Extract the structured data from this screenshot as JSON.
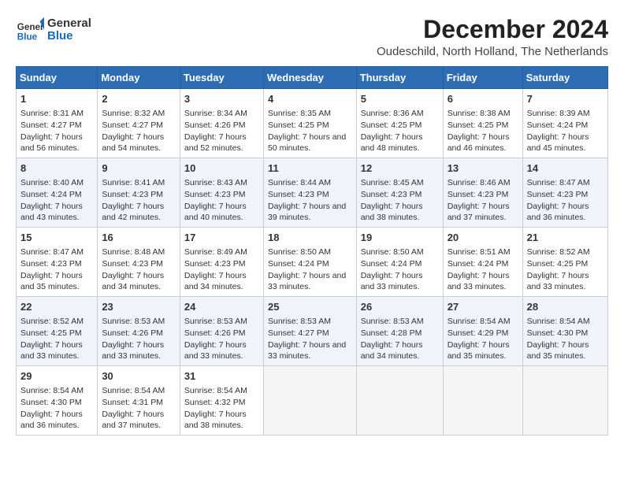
{
  "header": {
    "logo_general": "General",
    "logo_blue": "Blue",
    "title": "December 2024",
    "location": "Oudeschild, North Holland, The Netherlands"
  },
  "calendar": {
    "days_of_week": [
      "Sunday",
      "Monday",
      "Tuesday",
      "Wednesday",
      "Thursday",
      "Friday",
      "Saturday"
    ],
    "weeks": [
      [
        {
          "day": 1,
          "sunrise": "8:31 AM",
          "sunset": "4:27 PM",
          "daylight": "7 hours and 56 minutes."
        },
        {
          "day": 2,
          "sunrise": "8:32 AM",
          "sunset": "4:27 PM",
          "daylight": "7 hours and 54 minutes."
        },
        {
          "day": 3,
          "sunrise": "8:34 AM",
          "sunset": "4:26 PM",
          "daylight": "7 hours and 52 minutes."
        },
        {
          "day": 4,
          "sunrise": "8:35 AM",
          "sunset": "4:25 PM",
          "daylight": "7 hours and 50 minutes."
        },
        {
          "day": 5,
          "sunrise": "8:36 AM",
          "sunset": "4:25 PM",
          "daylight": "7 hours and 48 minutes."
        },
        {
          "day": 6,
          "sunrise": "8:38 AM",
          "sunset": "4:25 PM",
          "daylight": "7 hours and 46 minutes."
        },
        {
          "day": 7,
          "sunrise": "8:39 AM",
          "sunset": "4:24 PM",
          "daylight": "7 hours and 45 minutes."
        }
      ],
      [
        {
          "day": 8,
          "sunrise": "8:40 AM",
          "sunset": "4:24 PM",
          "daylight": "7 hours and 43 minutes."
        },
        {
          "day": 9,
          "sunrise": "8:41 AM",
          "sunset": "4:23 PM",
          "daylight": "7 hours and 42 minutes."
        },
        {
          "day": 10,
          "sunrise": "8:43 AM",
          "sunset": "4:23 PM",
          "daylight": "7 hours and 40 minutes."
        },
        {
          "day": 11,
          "sunrise": "8:44 AM",
          "sunset": "4:23 PM",
          "daylight": "7 hours and 39 minutes."
        },
        {
          "day": 12,
          "sunrise": "8:45 AM",
          "sunset": "4:23 PM",
          "daylight": "7 hours and 38 minutes."
        },
        {
          "day": 13,
          "sunrise": "8:46 AM",
          "sunset": "4:23 PM",
          "daylight": "7 hours and 37 minutes."
        },
        {
          "day": 14,
          "sunrise": "8:47 AM",
          "sunset": "4:23 PM",
          "daylight": "7 hours and 36 minutes."
        }
      ],
      [
        {
          "day": 15,
          "sunrise": "8:47 AM",
          "sunset": "4:23 PM",
          "daylight": "7 hours and 35 minutes."
        },
        {
          "day": 16,
          "sunrise": "8:48 AM",
          "sunset": "4:23 PM",
          "daylight": "7 hours and 34 minutes."
        },
        {
          "day": 17,
          "sunrise": "8:49 AM",
          "sunset": "4:23 PM",
          "daylight": "7 hours and 34 minutes."
        },
        {
          "day": 18,
          "sunrise": "8:50 AM",
          "sunset": "4:24 PM",
          "daylight": "7 hours and 33 minutes."
        },
        {
          "day": 19,
          "sunrise": "8:50 AM",
          "sunset": "4:24 PM",
          "daylight": "7 hours and 33 minutes."
        },
        {
          "day": 20,
          "sunrise": "8:51 AM",
          "sunset": "4:24 PM",
          "daylight": "7 hours and 33 minutes."
        },
        {
          "day": 21,
          "sunrise": "8:52 AM",
          "sunset": "4:25 PM",
          "daylight": "7 hours and 33 minutes."
        }
      ],
      [
        {
          "day": 22,
          "sunrise": "8:52 AM",
          "sunset": "4:25 PM",
          "daylight": "7 hours and 33 minutes."
        },
        {
          "day": 23,
          "sunrise": "8:53 AM",
          "sunset": "4:26 PM",
          "daylight": "7 hours and 33 minutes."
        },
        {
          "day": 24,
          "sunrise": "8:53 AM",
          "sunset": "4:26 PM",
          "daylight": "7 hours and 33 minutes."
        },
        {
          "day": 25,
          "sunrise": "8:53 AM",
          "sunset": "4:27 PM",
          "daylight": "7 hours and 33 minutes."
        },
        {
          "day": 26,
          "sunrise": "8:53 AM",
          "sunset": "4:28 PM",
          "daylight": "7 hours and 34 minutes."
        },
        {
          "day": 27,
          "sunrise": "8:54 AM",
          "sunset": "4:29 PM",
          "daylight": "7 hours and 35 minutes."
        },
        {
          "day": 28,
          "sunrise": "8:54 AM",
          "sunset": "4:30 PM",
          "daylight": "7 hours and 35 minutes."
        }
      ],
      [
        {
          "day": 29,
          "sunrise": "8:54 AM",
          "sunset": "4:30 PM",
          "daylight": "7 hours and 36 minutes."
        },
        {
          "day": 30,
          "sunrise": "8:54 AM",
          "sunset": "4:31 PM",
          "daylight": "7 hours and 37 minutes."
        },
        {
          "day": 31,
          "sunrise": "8:54 AM",
          "sunset": "4:32 PM",
          "daylight": "7 hours and 38 minutes."
        },
        null,
        null,
        null,
        null
      ]
    ]
  }
}
